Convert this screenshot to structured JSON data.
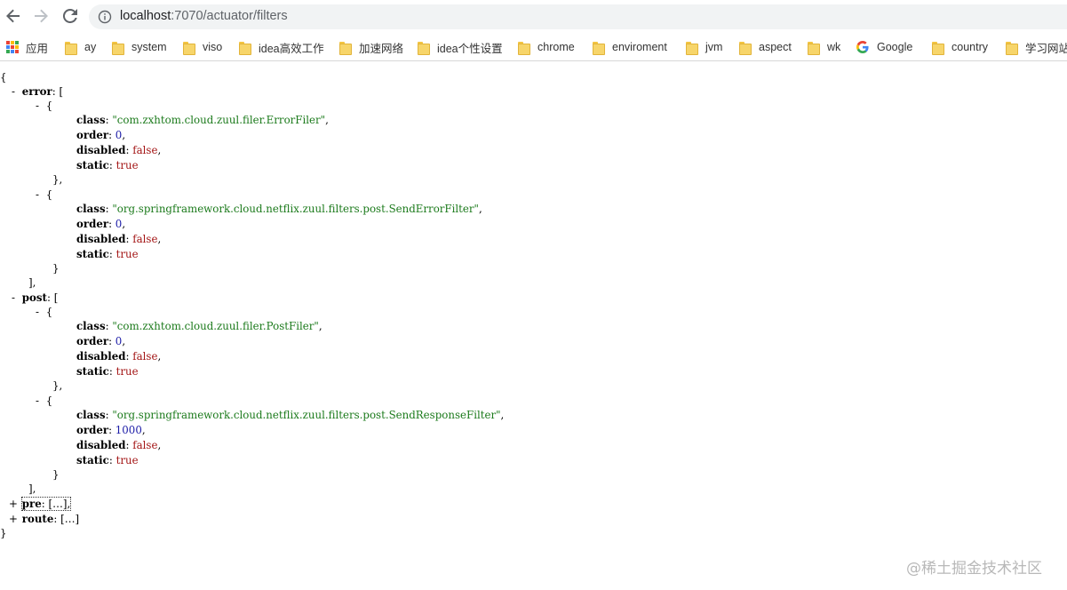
{
  "browser": {
    "url_host": "localhost",
    "url_path": ":7070/actuator/filters"
  },
  "bookmarks": [
    {
      "label": "应用",
      "icon": "apps-grid-icon"
    },
    {
      "label": "ay",
      "icon": "folder-icon"
    },
    {
      "label": "system",
      "icon": "folder-icon"
    },
    {
      "label": "viso",
      "icon": "folder-icon"
    },
    {
      "label": "idea高效工作",
      "icon": "folder-icon"
    },
    {
      "label": "加速网络",
      "icon": "folder-icon"
    },
    {
      "label": "idea个性设置",
      "icon": "folder-icon"
    },
    {
      "label": "chrome",
      "icon": "folder-icon"
    },
    {
      "label": "enviroment",
      "icon": "folder-icon"
    },
    {
      "label": "jvm",
      "icon": "folder-icon"
    },
    {
      "label": "aspect",
      "icon": "folder-icon"
    },
    {
      "label": "wk",
      "icon": "folder-icon"
    },
    {
      "label": "Google",
      "icon": "google-icon"
    },
    {
      "label": "country",
      "icon": "folder-icon"
    },
    {
      "label": "学习网站",
      "icon": "folder-icon"
    }
  ],
  "json": {
    "keys": {
      "error": "error",
      "post": "post",
      "pre": "pre",
      "route": "route",
      "class": "class",
      "order": "order",
      "disabled": "disabled",
      "static": "static"
    },
    "collapsed_marker": "[…]",
    "error": [
      {
        "class": "\"com.zxhtom.cloud.zuul.filer.ErrorFiler\"",
        "order": "0",
        "disabled": "false",
        "static": "true"
      },
      {
        "class": "\"org.springframework.cloud.netflix.zuul.filters.post.SendErrorFilter\"",
        "order": "0",
        "disabled": "false",
        "static": "true"
      }
    ],
    "post": [
      {
        "class": "\"com.zxhtom.cloud.zuul.filer.PostFiler\"",
        "order": "0",
        "disabled": "false",
        "static": "true"
      },
      {
        "class": "\"org.springframework.cloud.netflix.zuul.filters.post.SendResponseFilter\"",
        "order": "1000",
        "disabled": "false",
        "static": "true"
      }
    ]
  },
  "watermark": "@稀土掘金技术社区",
  "colors": {
    "string": "#1b7a1b",
    "number": "#1a1aa6",
    "boolean": "#a31515"
  }
}
